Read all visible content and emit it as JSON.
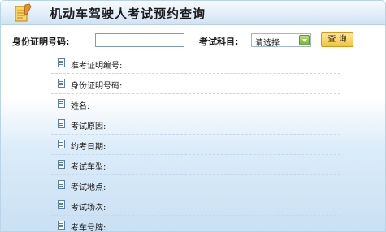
{
  "title": "机动车驾驶人考试预约查询",
  "search": {
    "id_label": "身份证明号码:",
    "id_value": "",
    "subject_label": "考试科目:",
    "subject_selected": "请选择",
    "query_label": "查 询"
  },
  "fields": [
    {
      "label": "准考证明编号:"
    },
    {
      "label": "身份证明号码:"
    },
    {
      "label": "姓名:"
    },
    {
      "label": "考试原因:"
    },
    {
      "label": "约考日期:"
    },
    {
      "label": "考试车型:"
    },
    {
      "label": "考试地点:"
    },
    {
      "label": "考试场次:"
    },
    {
      "label": "考车号牌:"
    }
  ]
}
